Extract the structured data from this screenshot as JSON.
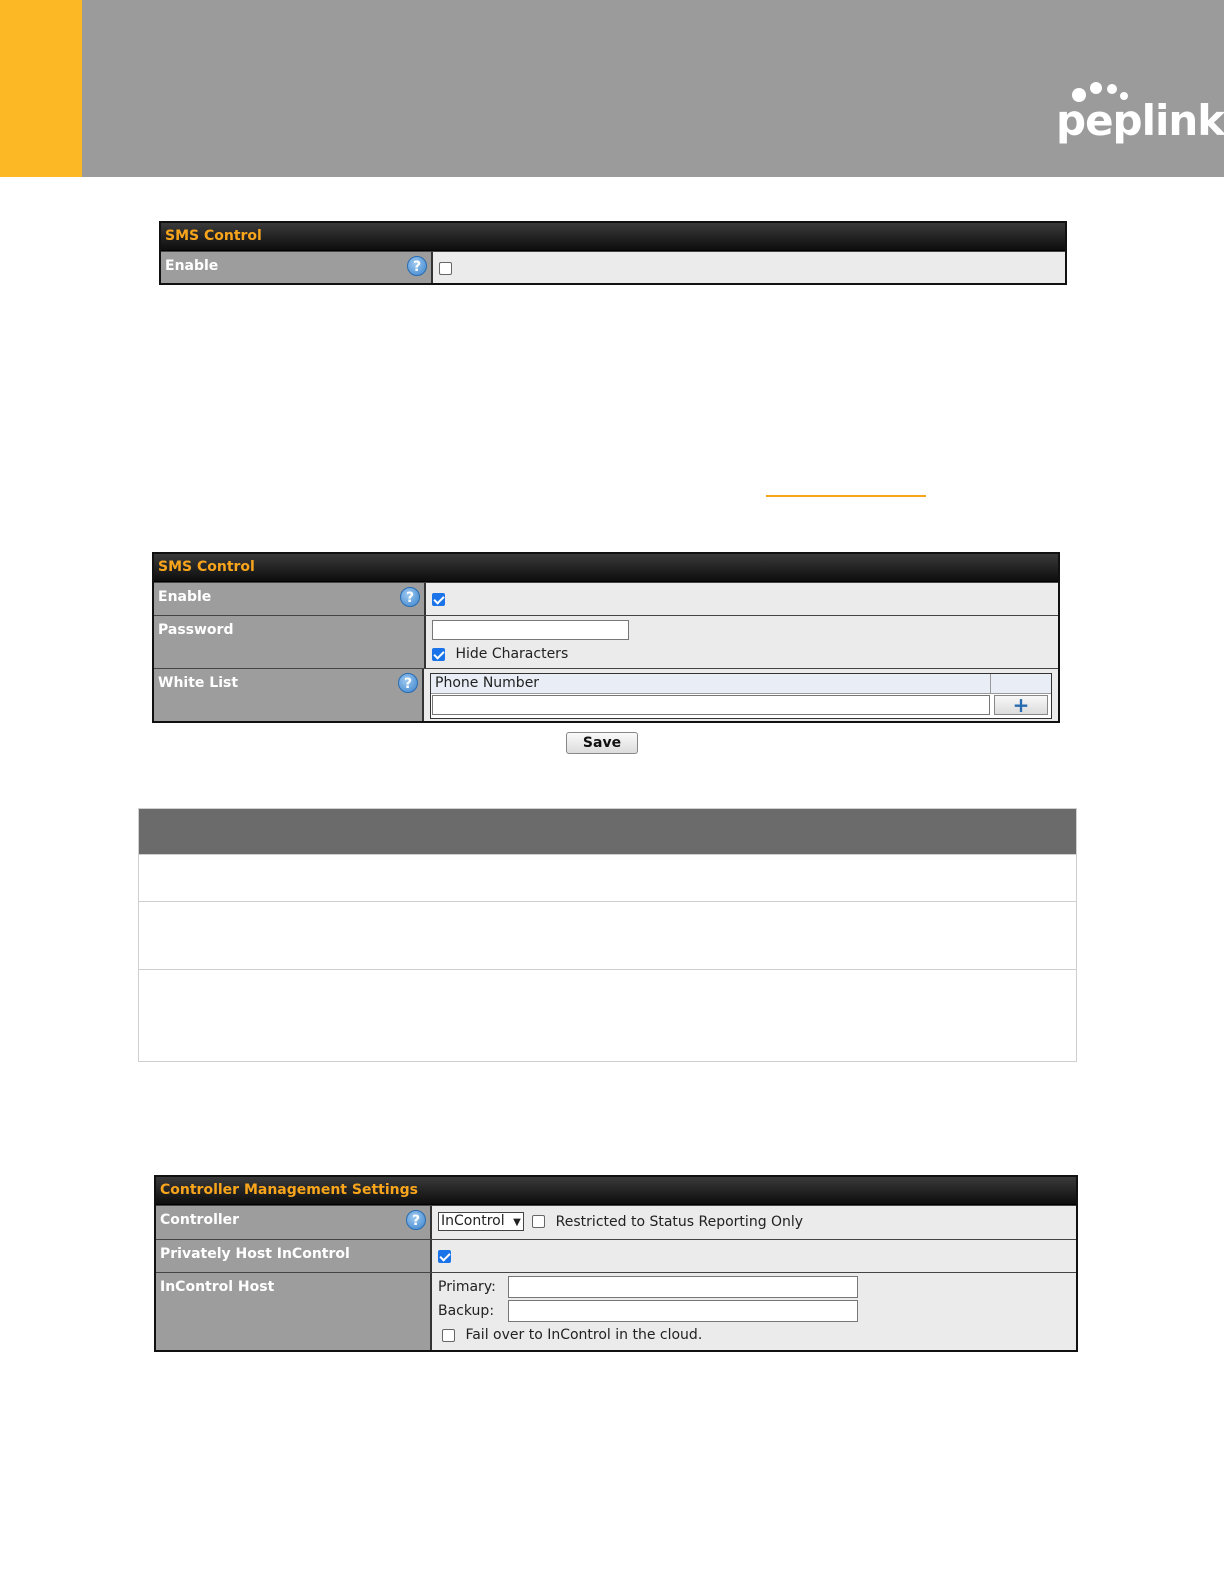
{
  "brand": {
    "logo_text": "peplink",
    "accent": "#fdb826",
    "header_bg": "#9b9b9b",
    "title_color": "#f8a51c"
  },
  "sms_control_1": {
    "title": "SMS Control",
    "enable_label": "Enable",
    "enable_checked": false
  },
  "sms_control_2": {
    "title": "SMS Control",
    "enable_label": "Enable",
    "enable_checked": true,
    "password_label": "Password",
    "password_value": "",
    "hide_characters_label": "Hide Characters",
    "hide_characters_checked": true,
    "white_list_label": "White List",
    "phone_number_header": "Phone Number",
    "phone_number_value": "",
    "add_icon": "plus-icon"
  },
  "save_button_label": "Save",
  "controller_settings": {
    "title": "Controller Management Settings",
    "controller_label": "Controller",
    "controller_selected": "InControl",
    "restricted_label": "Restricted to Status Reporting Only",
    "restricted_checked": false,
    "privately_host_label": "Privately Host InControl",
    "privately_host_checked": true,
    "incontrol_host_label": "InControl Host",
    "primary_label": "Primary:",
    "primary_value": "",
    "backup_label": "Backup:",
    "backup_value": "",
    "failover_label": "Fail over to InControl in the cloud.",
    "failover_checked": false
  }
}
